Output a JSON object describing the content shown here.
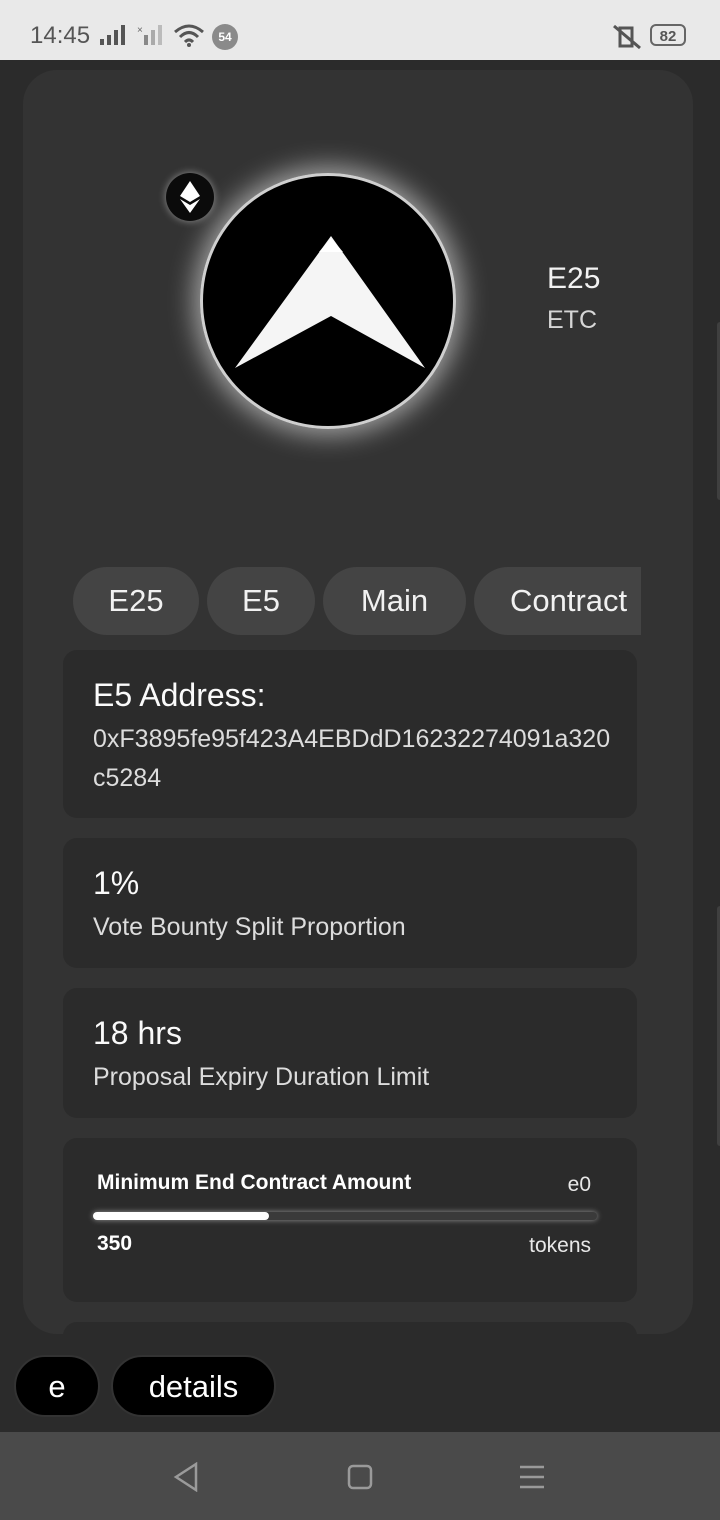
{
  "status_bar": {
    "time": "14:45",
    "notification_count": "54",
    "battery": "82"
  },
  "header": {
    "token_name": "E25",
    "chain": "ETC"
  },
  "tabs": [
    {
      "label": "E25"
    },
    {
      "label": "E5"
    },
    {
      "label": "Main"
    },
    {
      "label": "Contract"
    }
  ],
  "address_box": {
    "title": "E5 Address:",
    "value": "0xF3895fe95f423A4EBDdD16232274091a320c5284"
  },
  "stat1": {
    "value": "1%",
    "label": "Vote Bounty Split Proportion"
  },
  "stat2": {
    "value": "18 hrs",
    "label": "Proposal Expiry Duration Limit"
  },
  "min_end": {
    "label": "Minimum End Contract Amount",
    "unit_top": "e0",
    "value": "350",
    "unit_bottom": "tokens",
    "fill_fraction": 0.35
  },
  "bottom_buttons": {
    "e": "e",
    "details": "details"
  },
  "colors": {
    "background": "#2b2b2b",
    "card": "#333333",
    "tab": "#444444",
    "nav": "#4a4a4a"
  }
}
